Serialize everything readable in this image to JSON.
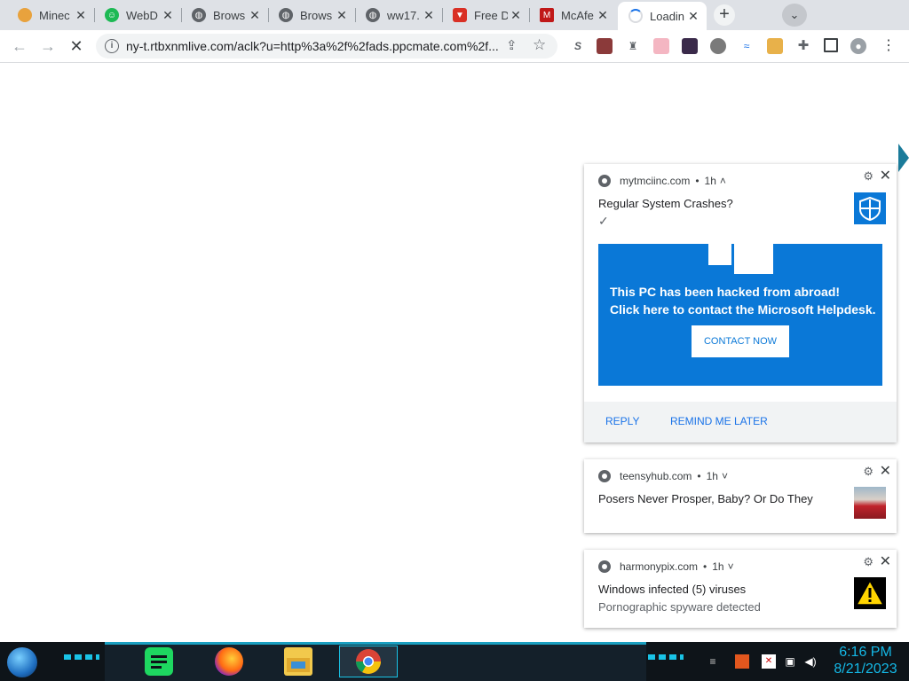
{
  "tabs": [
    {
      "title": "Minec",
      "favicon": "rainbow-icon",
      "color": "#e8a23d"
    },
    {
      "title": "WebD",
      "favicon": "green-smile-icon",
      "color": "#1db954"
    },
    {
      "title": "Brows",
      "favicon": "globe-icon",
      "color": "#5f6368"
    },
    {
      "title": "Brows",
      "favicon": "globe-icon",
      "color": "#5f6368"
    },
    {
      "title": "ww17.",
      "favicon": "globe-icon",
      "color": "#5f6368"
    },
    {
      "title": "Free D",
      "favicon": "shield-icon",
      "color": "#d93025"
    },
    {
      "title": "McAfe",
      "favicon": "mcafee-icon",
      "color": "#c01818"
    },
    {
      "title": "Loadin",
      "favicon": "loading-spinner-icon",
      "color": "#9aa0a6"
    }
  ],
  "toolbar": {
    "url": "ny-t.rtbxnmlive.com/aclk?u=http%3a%2f%2fads.ppcmate.com%2f..."
  },
  "notifications": [
    {
      "site": "mytmciinc.com",
      "time": "1h",
      "title": "Regular System Crashes?",
      "banner_line1": "This PC has been hacked from abroad!",
      "banner_line2": "Click here to contact the Microsoft Helpdesk.",
      "banner_button": "CONTACT NOW",
      "action1": "REPLY",
      "action2": "REMIND ME LATER"
    },
    {
      "site": "teensyhub.com",
      "time": "1h",
      "title": "Posers Never Prosper, Baby? Or Do They"
    },
    {
      "site": "harmonypix.com",
      "time": "1h",
      "title": "Windows infected (5) viruses",
      "subtitle": "Pornographic spyware detected"
    }
  ],
  "taskbar": {
    "time": "6:16 PM",
    "date": "8/21/2023"
  }
}
